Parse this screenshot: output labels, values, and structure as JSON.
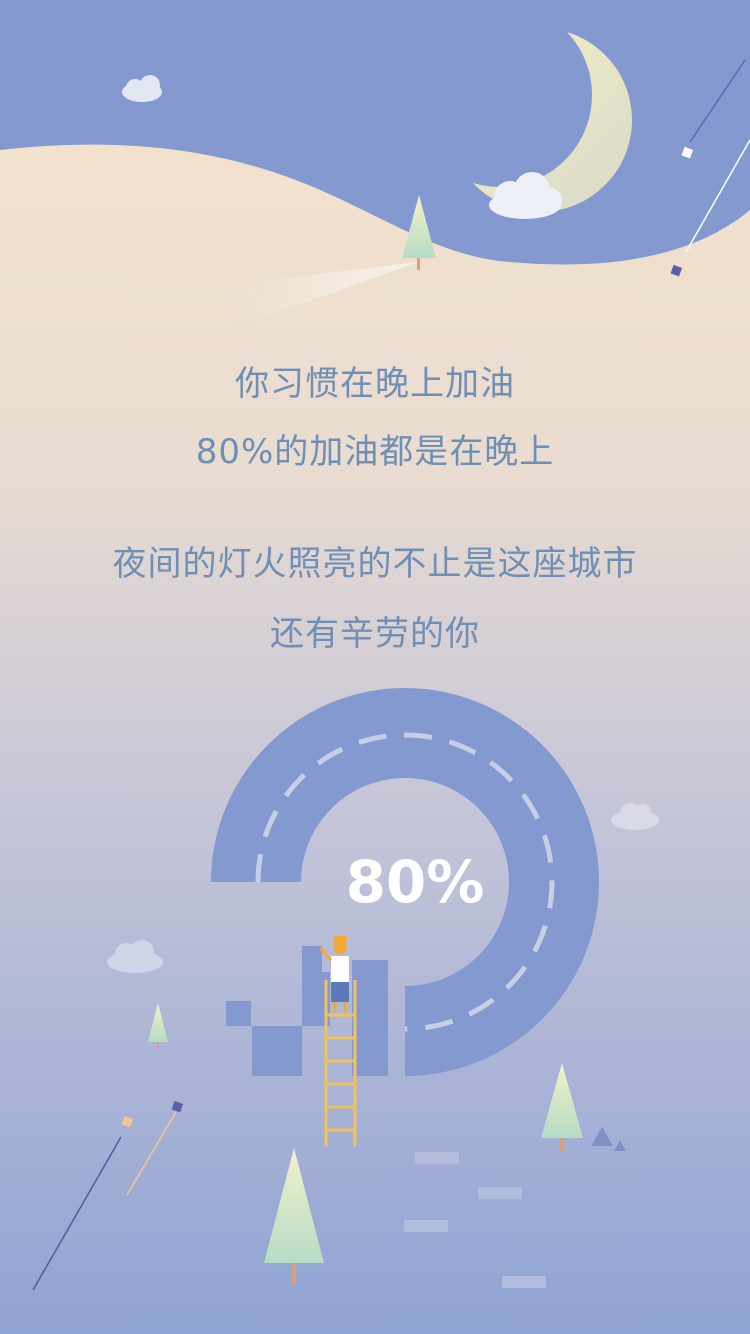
{
  "text": {
    "line1": "你习惯在晚上加油",
    "line2": "80%的加油都是在晚上",
    "line3": "夜间的灯火照亮的不止是这座城市",
    "line4": "还有辛劳的你"
  },
  "progress": {
    "label": "80%",
    "value": 0.8
  },
  "colors": {
    "sky_blue": "#8499cf",
    "hill": "#f5e3cb",
    "text": "#6f8fb6",
    "ring": "#8499cf",
    "moon": "#f3eec2",
    "ladder": "#f0c35a"
  }
}
